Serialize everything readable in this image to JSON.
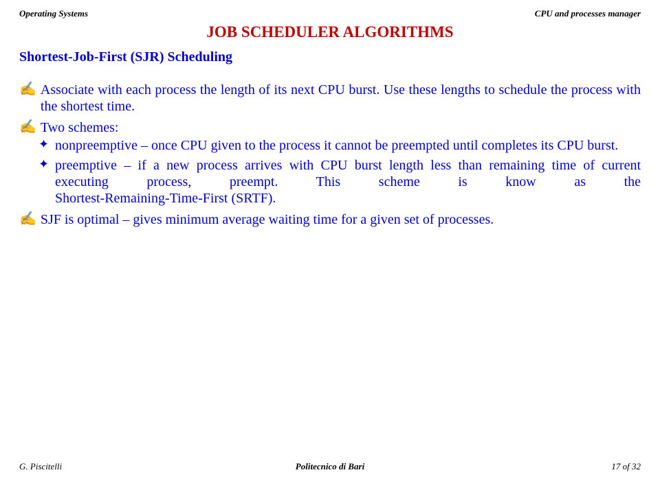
{
  "header": {
    "left": "Operating Systems",
    "right": "CPU and processes manager"
  },
  "title": "JOB SCHEDULER ALGORITHMS",
  "section": "Shortest-Job-First (SJR) Scheduling",
  "bullets": {
    "b1": "Associate with each process the length of its next CPU burst. Use these lengths to schedule the process with the shortest time.",
    "b2": "Two schemes:",
    "b2a": "nonpreemptive – once CPU given to the process it cannot be preempted until completes its CPU burst.",
    "b2b_line1": "preemptive – if a new process arrives with CPU burst length less than remaining time of current",
    "b2b_line2": "executing process, preempt. This scheme is know as the",
    "b2b_line3": "Shortest-Remaining-Time-First (SRTF).",
    "b3": "SJF is optimal – gives minimum average waiting time for a given set of processes."
  },
  "footer": {
    "left": "G. Piscitelli",
    "center": "Politecnico di Bari",
    "right": "17 of 32"
  }
}
